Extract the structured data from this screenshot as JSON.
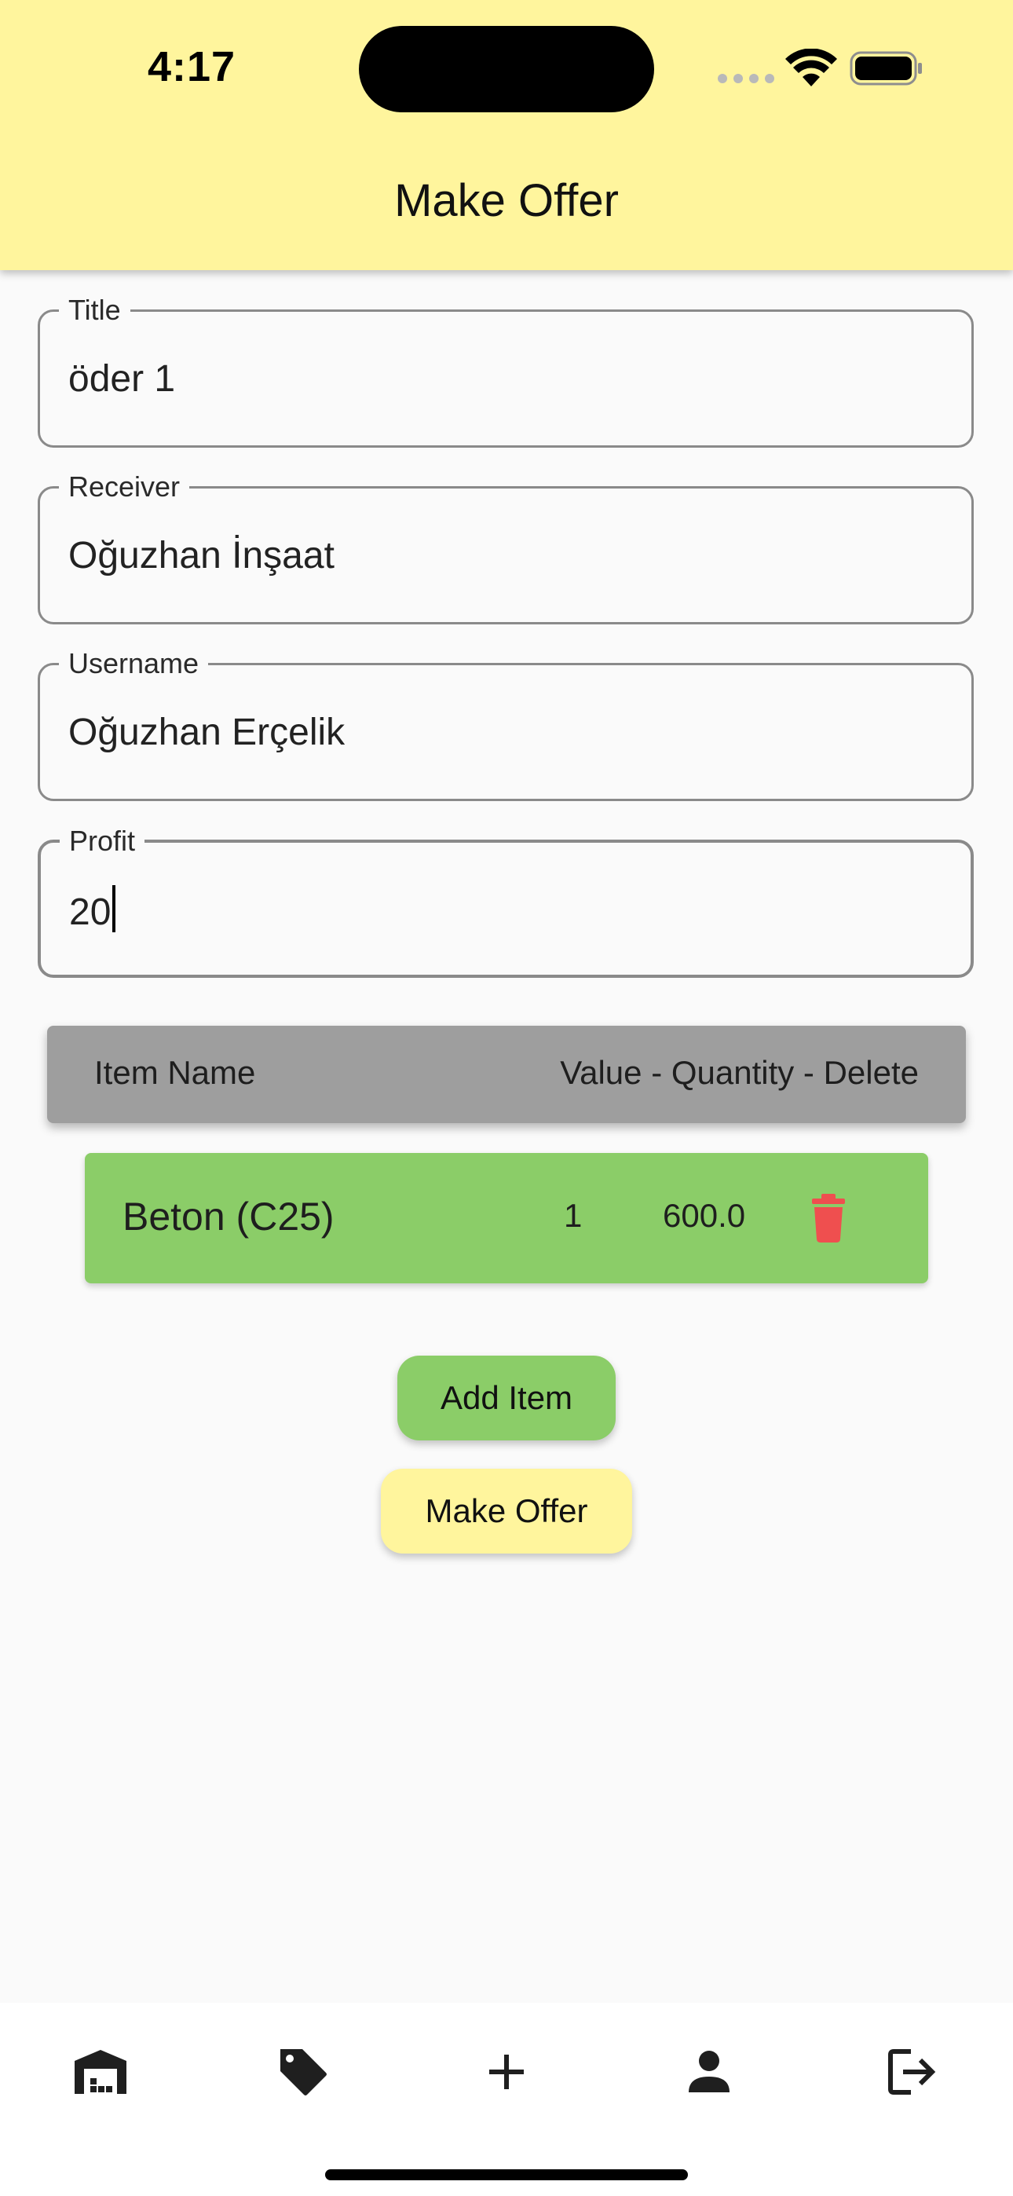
{
  "status_bar": {
    "time": "4:17"
  },
  "header": {
    "title": "Make Offer",
    "background": "#fff59d"
  },
  "form": {
    "title": {
      "label": "Title",
      "value": "öder 1"
    },
    "receiver": {
      "label": "Receiver",
      "value": "Oğuzhan İnşaat"
    },
    "username": {
      "label": "Username",
      "value": "Oğuzhan Erçelik"
    },
    "profit": {
      "label": "Profit",
      "value": "20"
    }
  },
  "table": {
    "header_left": "Item Name",
    "header_right": "Value - Quantity - Delete",
    "rows": [
      {
        "name": "Beton (C25)",
        "quantity": "1",
        "value": "600.0"
      }
    ]
  },
  "buttons": {
    "add_item": "Add Item",
    "make_offer": "Make Offer"
  },
  "bottom_nav": {
    "items": [
      "warehouse-icon",
      "tag-icon",
      "plus-icon",
      "person-icon",
      "logout-icon"
    ]
  },
  "colors": {
    "accent_yellow": "#fff59d",
    "accent_green": "#8bcd68",
    "header_grey": "#9e9e9e",
    "delete_red": "#ef4f4f"
  }
}
